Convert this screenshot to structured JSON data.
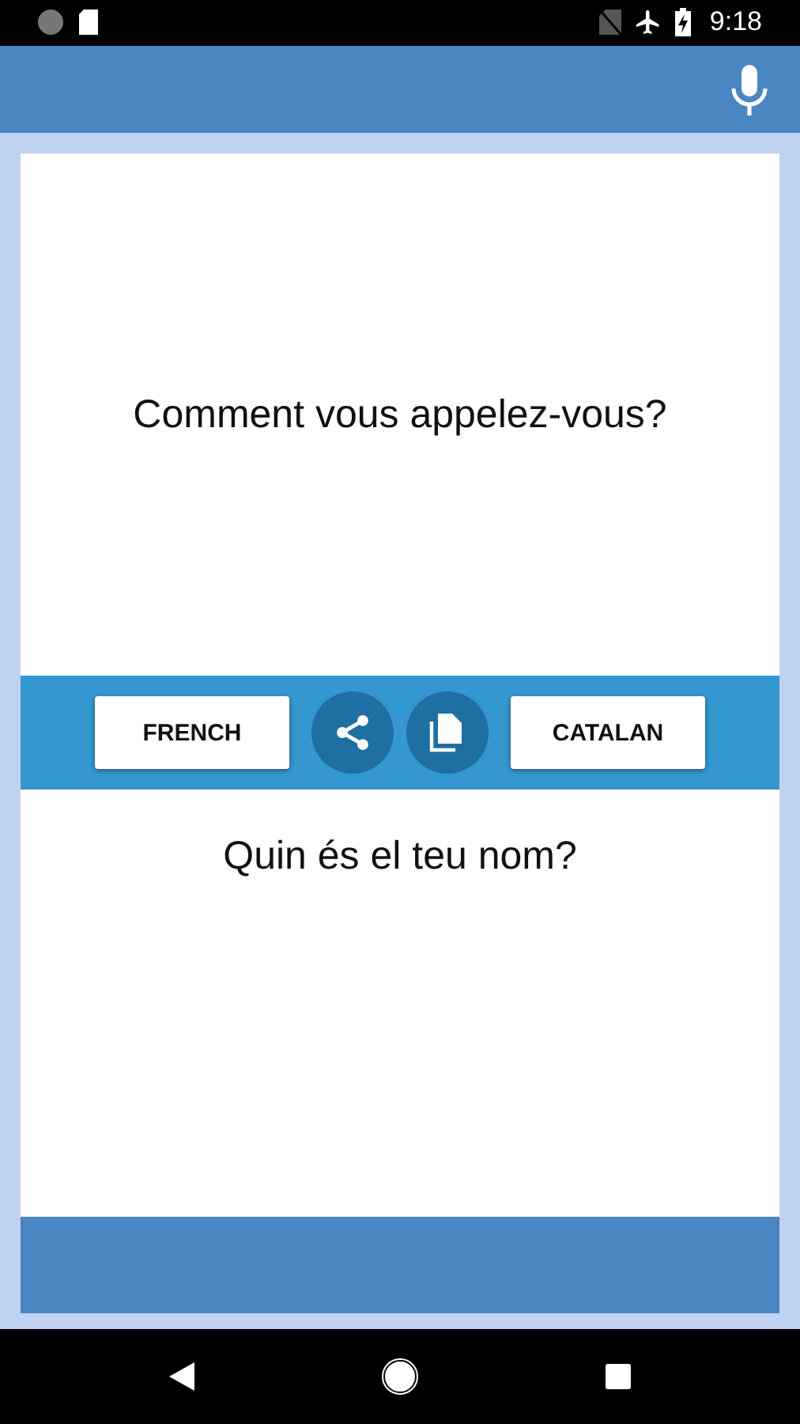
{
  "status_bar": {
    "time": "9:18"
  },
  "source": {
    "text": "Comment vous appelez-vous?"
  },
  "languages": {
    "from": "FRENCH",
    "to": "CATALAN"
  },
  "translation": {
    "text": "Quin és el teu nom?"
  }
}
